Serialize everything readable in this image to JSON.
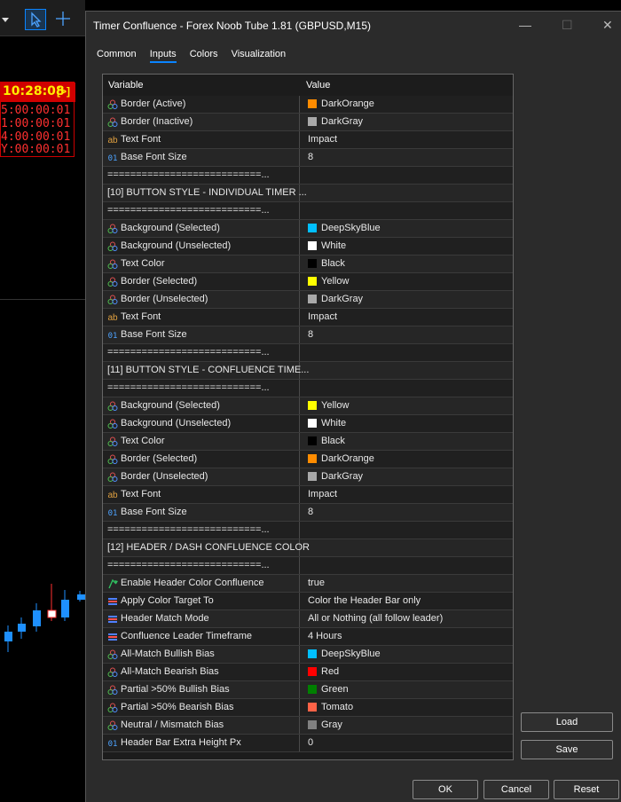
{
  "chart": {
    "timer_clock": "10:28:08",
    "timer_button": "[>]",
    "timer_lines": [
      "5:00:00:01",
      "1:00:00:01",
      "4:00:00:01",
      "Y:00:00:01"
    ],
    "candle_colors": {
      "bull": "#1e90ff",
      "bear": "#ffffff",
      "wick": "#ff3030"
    }
  },
  "dialog": {
    "title": "Timer Confluence - Forex Noob Tube 1.81 (GBPUSD,M15)",
    "controls": {
      "minimize": "—",
      "maximize": "☐",
      "close": "✕"
    },
    "tabs": [
      "Common",
      "Inputs",
      "Colors",
      "Visualization"
    ],
    "active_tab": "Inputs",
    "columns": {
      "variable": "Variable",
      "value": "Value"
    },
    "rows": [
      {
        "icon": "color",
        "label": "Border (Active)",
        "value": "DarkOrange",
        "swatch": "#ff8c00"
      },
      {
        "icon": "color",
        "label": "Border (Inactive)",
        "value": "DarkGray",
        "swatch": "#a9a9a9"
      },
      {
        "icon": "text",
        "label": "Text Font",
        "value": "Impact"
      },
      {
        "icon": "int",
        "label": "Base Font Size",
        "value": "8"
      },
      {
        "icon": "none",
        "label": "===========================...",
        "value": ""
      },
      {
        "icon": "none",
        "label": "[10] BUTTON STYLE - INDIVIDUAL TIMER ...",
        "value": ""
      },
      {
        "icon": "none",
        "label": "===========================...",
        "value": ""
      },
      {
        "icon": "color",
        "label": "Background (Selected)",
        "value": "DeepSkyBlue",
        "swatch": "#00bfff"
      },
      {
        "icon": "color",
        "label": "Background (Unselected)",
        "value": "White",
        "swatch": "#ffffff"
      },
      {
        "icon": "color",
        "label": "Text Color",
        "value": "Black",
        "swatch": "#000000"
      },
      {
        "icon": "color",
        "label": "Border (Selected)",
        "value": "Yellow",
        "swatch": "#ffff00"
      },
      {
        "icon": "color",
        "label": "Border (Unselected)",
        "value": "DarkGray",
        "swatch": "#a9a9a9"
      },
      {
        "icon": "text",
        "label": "Text Font",
        "value": "Impact"
      },
      {
        "icon": "int",
        "label": "Base Font Size",
        "value": "8"
      },
      {
        "icon": "none",
        "label": "===========================...",
        "value": ""
      },
      {
        "icon": "none",
        "label": "[11] BUTTON STYLE - CONFLUENCE TIME...",
        "value": ""
      },
      {
        "icon": "none",
        "label": "===========================...",
        "value": ""
      },
      {
        "icon": "color",
        "label": "Background (Selected)",
        "value": "Yellow",
        "swatch": "#ffff00"
      },
      {
        "icon": "color",
        "label": "Background (Unselected)",
        "value": "White",
        "swatch": "#ffffff"
      },
      {
        "icon": "color",
        "label": "Text Color",
        "value": "Black",
        "swatch": "#000000"
      },
      {
        "icon": "color",
        "label": "Border (Selected)",
        "value": "DarkOrange",
        "swatch": "#ff8c00"
      },
      {
        "icon": "color",
        "label": "Border (Unselected)",
        "value": "DarkGray",
        "swatch": "#a9a9a9"
      },
      {
        "icon": "text",
        "label": "Text Font",
        "value": "Impact"
      },
      {
        "icon": "int",
        "label": "Base Font Size",
        "value": "8"
      },
      {
        "icon": "none",
        "label": "===========================...",
        "value": ""
      },
      {
        "icon": "none",
        "label": "[12] HEADER / DASH CONFLUENCE COLOR",
        "value": ""
      },
      {
        "icon": "none",
        "label": "===========================...",
        "value": ""
      },
      {
        "icon": "bool",
        "label": "Enable Header Color Confluence",
        "value": "true"
      },
      {
        "icon": "enum",
        "label": "Apply Color Target To",
        "value": "Color the Header Bar only"
      },
      {
        "icon": "enum",
        "label": "Header Match Mode",
        "value": "All or Nothing (all follow leader)"
      },
      {
        "icon": "enum",
        "label": "Confluence Leader Timeframe",
        "value": "4 Hours"
      },
      {
        "icon": "color",
        "label": "All-Match Bullish Bias",
        "value": "DeepSkyBlue",
        "swatch": "#00bfff"
      },
      {
        "icon": "color",
        "label": "All-Match Bearish Bias",
        "value": "Red",
        "swatch": "#ff0000"
      },
      {
        "icon": "color",
        "label": "Partial >50% Bullish Bias",
        "value": "Green",
        "swatch": "#008000"
      },
      {
        "icon": "color",
        "label": "Partial >50% Bearish Bias",
        "value": "Tomato",
        "swatch": "#ff6347"
      },
      {
        "icon": "color",
        "label": "Neutral / Mismatch Bias",
        "value": "Gray",
        "swatch": "#808080"
      },
      {
        "icon": "int",
        "label": "Header Bar Extra Height Px",
        "value": "0"
      }
    ],
    "buttons": {
      "load": "Load",
      "save": "Save",
      "ok": "OK",
      "cancel": "Cancel",
      "reset": "Reset"
    }
  }
}
